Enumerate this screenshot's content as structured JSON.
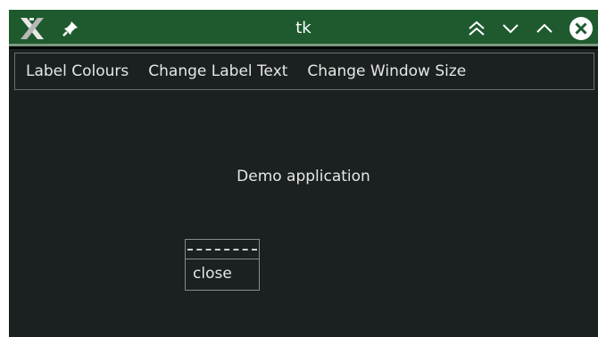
{
  "window": {
    "title": "tk"
  },
  "titlebar": {
    "icons": [
      "app-x-icon",
      "pin-icon",
      "shade-icon",
      "minimize-icon",
      "maximize-icon",
      "close-icon"
    ]
  },
  "menubar": {
    "items": [
      {
        "label": "Label Colours"
      },
      {
        "label": "Change Label Text"
      },
      {
        "label": "Change Window Size"
      }
    ]
  },
  "main": {
    "label": "Demo application"
  },
  "popup_menu": {
    "items": [
      {
        "label": "close"
      }
    ]
  },
  "colors": {
    "titlebar": "#1e5a2e",
    "client_bg": "#1b2020",
    "text": "#e6e6e6"
  }
}
